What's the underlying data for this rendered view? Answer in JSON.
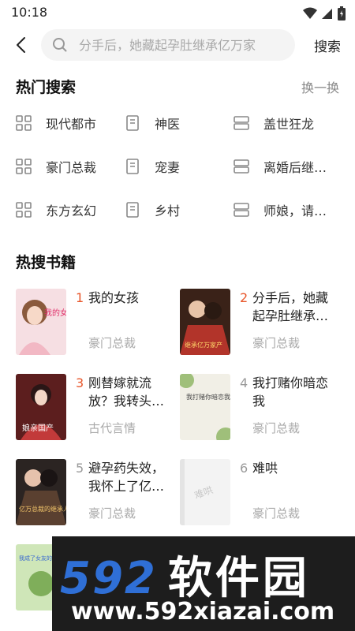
{
  "status_bar": {
    "time": "10:18"
  },
  "search": {
    "placeholder": "分手后，她藏起孕肚继承亿万家",
    "submit_label": "搜索"
  },
  "hot_search": {
    "title": "热门搜索",
    "refresh_label": "换一换",
    "items": [
      {
        "label": "现代都市",
        "icon": "grid-icon"
      },
      {
        "label": "神医",
        "icon": "book-icon"
      },
      {
        "label": "盖世狂龙",
        "icon": "list-icon"
      },
      {
        "label": "豪门总裁",
        "icon": "grid-icon"
      },
      {
        "label": "宠妻",
        "icon": "book-icon"
      },
      {
        "label": "离婚后继…",
        "icon": "list-icon"
      },
      {
        "label": "东方玄幻",
        "icon": "grid-icon"
      },
      {
        "label": "乡村",
        "icon": "book-icon"
      },
      {
        "label": "师娘，请…",
        "icon": "list-icon"
      }
    ]
  },
  "hot_books": {
    "title": "热搜书籍",
    "items": [
      {
        "rank": "1",
        "title": "我的女孩",
        "tag": "豪门总裁",
        "rank_color": "#e8562a"
      },
      {
        "rank": "2",
        "title": "分手后，她藏起孕肚继承…",
        "tag": "豪门总裁",
        "rank_color": "#e8562a"
      },
      {
        "rank": "3",
        "title": "刚替嫁就流放？我转头…",
        "tag": "古代言情",
        "rank_color": "#e8562a"
      },
      {
        "rank": "4",
        "title": "我打赌你暗恋我",
        "tag": "豪门总裁",
        "rank_color": "#999999"
      },
      {
        "rank": "5",
        "title": "避孕药失效，我怀上了亿…",
        "tag": "豪门总裁",
        "rank_color": "#999999"
      },
      {
        "rank": "6",
        "title": "难哄",
        "tag": "豪门总裁",
        "rank_color": "#999999"
      }
    ],
    "cover_texts": {
      "book1": "我的女孩",
      "book2": "继承亿万家产",
      "book3": "娘亲国产",
      "book4": "我打赌你暗恋我",
      "book5": "亿万总裁的继承人",
      "book6": "难哄",
      "book7": "我成了女友的舅舅"
    }
  },
  "watermark": {
    "numerals": "592",
    "name": "软件园",
    "url": "www.592xiazai.com"
  }
}
